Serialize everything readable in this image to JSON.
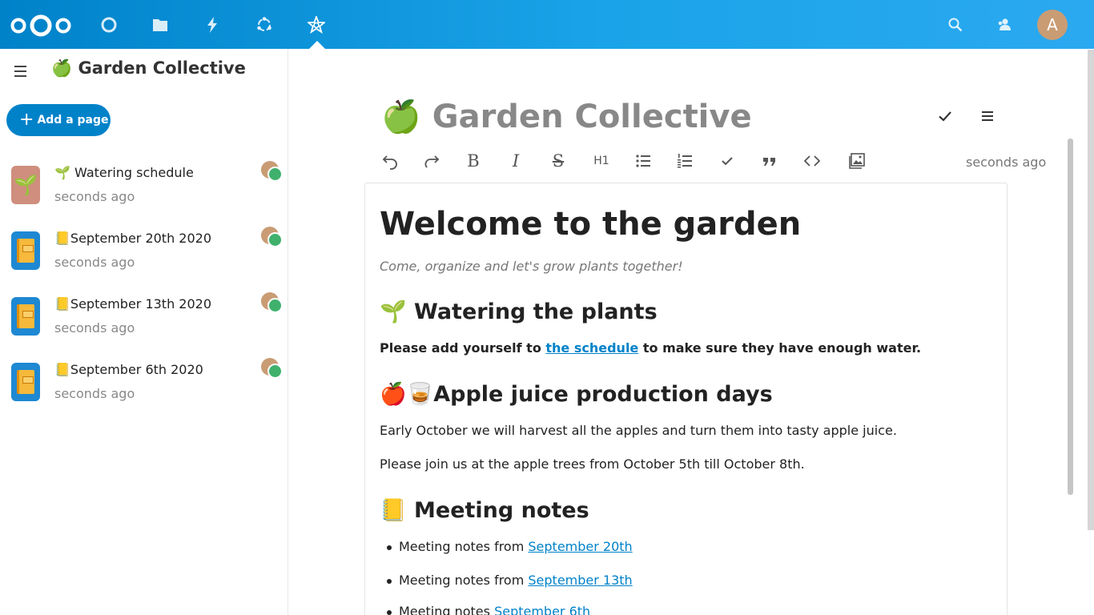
{
  "header": {
    "apps": [
      {
        "name": "dashboard-app",
        "icon": "circle-icon"
      },
      {
        "name": "files-app",
        "icon": "folder-icon"
      },
      {
        "name": "activity-app",
        "icon": "lightning-icon"
      },
      {
        "name": "circles-app",
        "icon": "sync-circles-icon"
      },
      {
        "name": "collectives-app",
        "icon": "collectives-star-icon",
        "active": true
      }
    ],
    "avatar_initial": "A",
    "right_icons": [
      "search-icon",
      "contacts-icon"
    ]
  },
  "sidebar": {
    "collective_emoji": "🍏",
    "collective_name": "Garden Collective",
    "add_page_label": "Add a page",
    "pages": [
      {
        "emoji": "🌱",
        "title": "Watering schedule",
        "time": "seconds ago"
      },
      {
        "emoji": "📒",
        "title": "September 20th 2020",
        "time": "seconds ago"
      },
      {
        "emoji": "📒",
        "title": "September 13th 2020",
        "time": "seconds ago"
      },
      {
        "emoji": "📒",
        "title": "September 6th 2020",
        "time": "seconds ago"
      }
    ]
  },
  "main": {
    "title_emoji": "🍏",
    "title": "Garden Collective",
    "saved_time": "seconds ago",
    "toolbar": {
      "heading_label": "H1",
      "bold_label": "B",
      "italic_label": "I",
      "strike_label": "S"
    },
    "content": {
      "h1": "Welcome to the garden",
      "subtitle": "Come, organize and let's grow plants together!",
      "section1_title": "🌱 Watering the plants",
      "section1_pre": "Please add yourself to ",
      "section1_link": "the schedule",
      "section1_post": " to make sure they have enough water.",
      "section2_title": "🍎🥃Apple juice production days",
      "section2_p1": "Early October we will harvest all the apples and turn them into tasty apple juice.",
      "section2_p2": "Please join us at the apple trees from October 5th till October 8th.",
      "section3_title": "📒 Meeting notes",
      "notes": [
        {
          "pre": "Meeting notes from ",
          "link": "September 20th"
        },
        {
          "pre": "Meeting notes from ",
          "link": "September 13th"
        },
        {
          "pre": "Meeting notes ",
          "link": "September 6th"
        }
      ]
    }
  },
  "colors": {
    "brand": "#0082c9",
    "link": "#0082c9",
    "avatar": "#c99c74",
    "status_online": "#3fb16d"
  }
}
